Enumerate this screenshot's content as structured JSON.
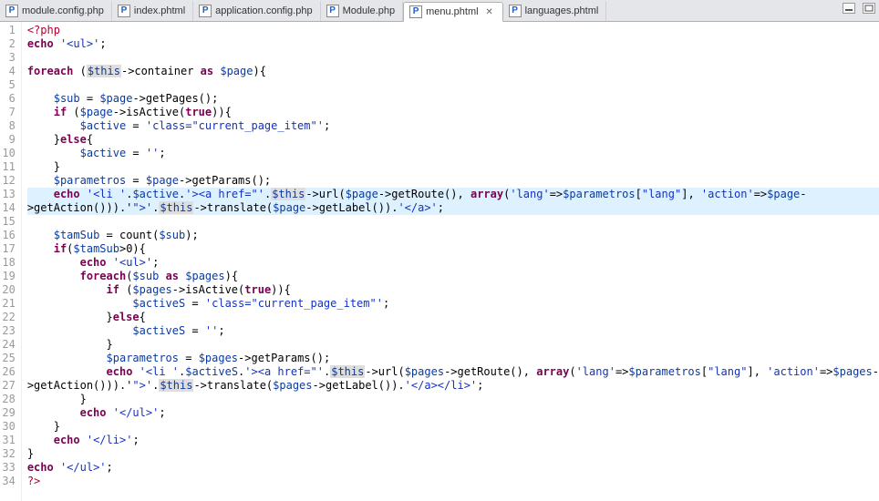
{
  "tabs": [
    {
      "label": "module.config.php",
      "active": false
    },
    {
      "label": "index.phtml",
      "active": false
    },
    {
      "label": "application.config.php",
      "active": false
    },
    {
      "label": "Module.php",
      "active": false
    },
    {
      "label": "menu.phtml",
      "active": true
    },
    {
      "label": "languages.phtml",
      "active": false
    }
  ],
  "p_icon": "P",
  "close_glyph": "✕",
  "highlight_lines": [
    13,
    14
  ],
  "code_lines": [
    {
      "n": 1,
      "t": [
        [
          "opentag",
          "<?php"
        ]
      ]
    },
    {
      "n": 2,
      "t": [
        [
          "k",
          "echo"
        ],
        [
          "p",
          " "
        ],
        [
          "st",
          "'<ul>'"
        ],
        [
          "p",
          ";"
        ]
      ]
    },
    {
      "n": 3,
      "t": []
    },
    {
      "n": 4,
      "t": [
        [
          "k",
          "foreach"
        ],
        [
          "p",
          " ("
        ],
        [
          "thv",
          "$this"
        ],
        [
          "p",
          "->container "
        ],
        [
          "k",
          "as"
        ],
        [
          "p",
          " "
        ],
        [
          "v",
          "$page"
        ],
        [
          "p",
          "){"
        ]
      ]
    },
    {
      "n": 5,
      "t": []
    },
    {
      "n": 6,
      "t": [
        [
          "p",
          "    "
        ],
        [
          "v",
          "$sub"
        ],
        [
          "p",
          " = "
        ],
        [
          "v",
          "$page"
        ],
        [
          "p",
          "->getPages();"
        ]
      ]
    },
    {
      "n": 7,
      "t": [
        [
          "p",
          "    "
        ],
        [
          "k",
          "if"
        ],
        [
          "p",
          " ("
        ],
        [
          "v",
          "$page"
        ],
        [
          "p",
          "->isActive("
        ],
        [
          "k",
          "true"
        ],
        [
          "p",
          ")){"
        ]
      ]
    },
    {
      "n": 8,
      "t": [
        [
          "p",
          "        "
        ],
        [
          "v",
          "$active"
        ],
        [
          "p",
          " = "
        ],
        [
          "st",
          "'class=\"current_page_item\"'"
        ],
        [
          "p",
          ";"
        ]
      ]
    },
    {
      "n": 9,
      "t": [
        [
          "p",
          "    }"
        ],
        [
          "k",
          "else"
        ],
        [
          "p",
          "{"
        ]
      ]
    },
    {
      "n": 10,
      "t": [
        [
          "p",
          "        "
        ],
        [
          "v",
          "$active"
        ],
        [
          "p",
          " = "
        ],
        [
          "st",
          "''"
        ],
        [
          "p",
          ";"
        ]
      ]
    },
    {
      "n": 11,
      "t": [
        [
          "p",
          "    }"
        ]
      ]
    },
    {
      "n": 12,
      "t": [
        [
          "p",
          "    "
        ],
        [
          "v",
          "$parametros"
        ],
        [
          "p",
          " = "
        ],
        [
          "v",
          "$page"
        ],
        [
          "p",
          "->getParams();"
        ]
      ]
    },
    {
      "n": 13,
      "t": [
        [
          "p",
          "    "
        ],
        [
          "k",
          "echo"
        ],
        [
          "p",
          " "
        ],
        [
          "st",
          "'<li '"
        ],
        [
          "p",
          "."
        ],
        [
          "v",
          "$active"
        ],
        [
          "p",
          "."
        ],
        [
          "st",
          "'><a href=\"'"
        ],
        [
          "p",
          "."
        ],
        [
          "thv",
          "$this"
        ],
        [
          "p",
          "->url("
        ],
        [
          "v",
          "$page"
        ],
        [
          "p",
          "->getRoute(), "
        ],
        [
          "k",
          "array"
        ],
        [
          "p",
          "("
        ],
        [
          "st",
          "'lang'"
        ],
        [
          "p",
          "=>"
        ],
        [
          "v",
          "$parametros"
        ],
        [
          "p",
          "["
        ],
        [
          "st",
          "\"lang\""
        ],
        [
          "p",
          "], "
        ],
        [
          "st",
          "'action'"
        ],
        [
          "p",
          "=>"
        ],
        [
          "v",
          "$page"
        ],
        [
          "p",
          "-"
        ]
      ]
    },
    {
      "n": 14,
      "t": [
        [
          "p",
          ">getAction())).'"
        ],
        [
          "st",
          "\">'"
        ],
        [
          "p",
          "."
        ],
        [
          "thv",
          "$this"
        ],
        [
          "p",
          "->translate("
        ],
        [
          "v",
          "$page"
        ],
        [
          "p",
          "->getLabel())."
        ],
        [
          "st",
          "'</a>'"
        ],
        [
          "p",
          ";"
        ]
      ]
    },
    {
      "n": 15,
      "t": []
    },
    {
      "n": 16,
      "t": [
        [
          "p",
          "    "
        ],
        [
          "v",
          "$tamSub"
        ],
        [
          "p",
          " = count("
        ],
        [
          "v",
          "$sub"
        ],
        [
          "p",
          ");"
        ]
      ]
    },
    {
      "n": 17,
      "t": [
        [
          "p",
          "    "
        ],
        [
          "k",
          "if"
        ],
        [
          "p",
          "("
        ],
        [
          "v",
          "$tamSub"
        ],
        [
          "p",
          ">0){"
        ]
      ]
    },
    {
      "n": 18,
      "t": [
        [
          "p",
          "        "
        ],
        [
          "k",
          "echo"
        ],
        [
          "p",
          " "
        ],
        [
          "st",
          "'<ul>'"
        ],
        [
          "p",
          ";"
        ]
      ]
    },
    {
      "n": 19,
      "t": [
        [
          "p",
          "        "
        ],
        [
          "k",
          "foreach"
        ],
        [
          "p",
          "("
        ],
        [
          "v",
          "$sub"
        ],
        [
          "p",
          " "
        ],
        [
          "k",
          "as"
        ],
        [
          "p",
          " "
        ],
        [
          "v",
          "$pages"
        ],
        [
          "p",
          "){"
        ]
      ]
    },
    {
      "n": 20,
      "t": [
        [
          "p",
          "            "
        ],
        [
          "k",
          "if"
        ],
        [
          "p",
          " ("
        ],
        [
          "v",
          "$pages"
        ],
        [
          "p",
          "->isActive("
        ],
        [
          "k",
          "true"
        ],
        [
          "p",
          ")){"
        ]
      ]
    },
    {
      "n": 21,
      "t": [
        [
          "p",
          "                "
        ],
        [
          "v",
          "$activeS"
        ],
        [
          "p",
          " = "
        ],
        [
          "st",
          "'class=\"current_page_item\"'"
        ],
        [
          "p",
          ";"
        ]
      ]
    },
    {
      "n": 22,
      "t": [
        [
          "p",
          "            }"
        ],
        [
          "k",
          "else"
        ],
        [
          "p",
          "{"
        ]
      ]
    },
    {
      "n": 23,
      "t": [
        [
          "p",
          "                "
        ],
        [
          "v",
          "$activeS"
        ],
        [
          "p",
          " = "
        ],
        [
          "st",
          "''"
        ],
        [
          "p",
          ";"
        ]
      ]
    },
    {
      "n": 24,
      "t": [
        [
          "p",
          "            }"
        ]
      ]
    },
    {
      "n": 25,
      "t": [
        [
          "p",
          "            "
        ],
        [
          "v",
          "$parametros"
        ],
        [
          "p",
          " = "
        ],
        [
          "v",
          "$pages"
        ],
        [
          "p",
          "->getParams();"
        ]
      ]
    },
    {
      "n": 26,
      "t": [
        [
          "p",
          "            "
        ],
        [
          "k",
          "echo"
        ],
        [
          "p",
          " "
        ],
        [
          "st",
          "'<li '"
        ],
        [
          "p",
          "."
        ],
        [
          "v",
          "$activeS"
        ],
        [
          "p",
          "."
        ],
        [
          "st",
          "'><a href=\"'"
        ],
        [
          "p",
          "."
        ],
        [
          "thv",
          "$this"
        ],
        [
          "p",
          "->url("
        ],
        [
          "v",
          "$pages"
        ],
        [
          "p",
          "->getRoute(), "
        ],
        [
          "k",
          "array"
        ],
        [
          "p",
          "("
        ],
        [
          "st",
          "'lang'"
        ],
        [
          "p",
          "=>"
        ],
        [
          "v",
          "$parametros"
        ],
        [
          "p",
          "["
        ],
        [
          "st",
          "\"lang\""
        ],
        [
          "p",
          "], "
        ],
        [
          "st",
          "'action'"
        ],
        [
          "p",
          "=>"
        ],
        [
          "v",
          "$pages"
        ],
        [
          "p",
          "-"
        ]
      ]
    },
    {
      "n": 27,
      "t": [
        [
          "p",
          ">getAction())).'"
        ],
        [
          "st",
          "\">'"
        ],
        [
          "p",
          "."
        ],
        [
          "thv",
          "$this"
        ],
        [
          "p",
          "->translate("
        ],
        [
          "v",
          "$pages"
        ],
        [
          "p",
          "->getLabel())."
        ],
        [
          "st",
          "'</a></li>'"
        ],
        [
          "p",
          ";"
        ]
      ]
    },
    {
      "n": 28,
      "t": [
        [
          "p",
          "        }"
        ]
      ]
    },
    {
      "n": 29,
      "t": [
        [
          "p",
          "        "
        ],
        [
          "k",
          "echo"
        ],
        [
          "p",
          " "
        ],
        [
          "st",
          "'</ul>'"
        ],
        [
          "p",
          ";"
        ]
      ]
    },
    {
      "n": 30,
      "t": [
        [
          "p",
          "    }"
        ]
      ]
    },
    {
      "n": 31,
      "t": [
        [
          "p",
          "    "
        ],
        [
          "k",
          "echo"
        ],
        [
          "p",
          " "
        ],
        [
          "st",
          "'</li>'"
        ],
        [
          "p",
          ";"
        ]
      ]
    },
    {
      "n": 32,
      "t": [
        [
          "p",
          "}"
        ]
      ]
    },
    {
      "n": 33,
      "t": [
        [
          "k",
          "echo"
        ],
        [
          "p",
          " "
        ],
        [
          "st",
          "'</ul>'"
        ],
        [
          "p",
          ";"
        ]
      ]
    },
    {
      "n": 34,
      "t": [
        [
          "opentag",
          "?>"
        ]
      ]
    }
  ]
}
